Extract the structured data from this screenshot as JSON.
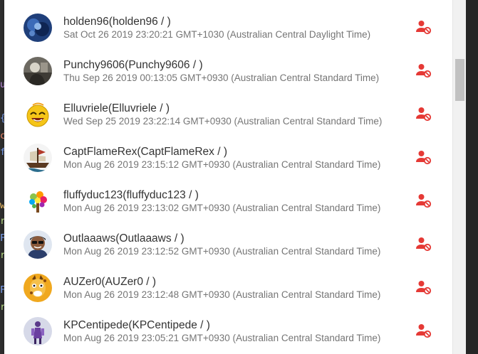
{
  "colors": {
    "accent_red": "#e53935",
    "name_text": "#333333",
    "date_text": "#757575"
  },
  "users": [
    {
      "name": "holden96(holden96 / )",
      "date": "Sat Oct 26 2019 23:20:21 GMT+1030 (Australian Central Daylight Time)",
      "avatar_icon": "avatar-photo-icon",
      "action_icon": "remove-user-icon"
    },
    {
      "name": "Punchy9606(Punchy9606 / )",
      "date": "Thu Sep 26 2019 00:13:05 GMT+0930 (Australian Central Standard Time)",
      "avatar_icon": "avatar-photo-icon",
      "action_icon": "remove-user-icon"
    },
    {
      "name": "Elluvriele(Elluvriele / )",
      "date": "Wed Sep 25 2019 23:22:14 GMT+0930 (Australian Central Standard Time)",
      "avatar_icon": "avatar-emoji-icon",
      "action_icon": "remove-user-icon"
    },
    {
      "name": "CaptFlameRex(CaptFlameRex / )",
      "date": "Mon Aug 26 2019 23:15:12 GMT+0930 (Australian Central Standard Time)",
      "avatar_icon": "avatar-ship-icon",
      "action_icon": "remove-user-icon"
    },
    {
      "name": "fluffyduc123(fluffyduc123 / )",
      "date": "Mon Aug 26 2019 23:13:02 GMT+0930 (Australian Central Standard Time)",
      "avatar_icon": "avatar-tree-icon",
      "action_icon": "remove-user-icon"
    },
    {
      "name": "Outlaaaws(Outlaaaws / )",
      "date": "Mon Aug 26 2019 23:12:52 GMT+0930 (Australian Central Standard Time)",
      "avatar_icon": "avatar-cartoon-icon",
      "action_icon": "remove-user-icon"
    },
    {
      "name": "AUZer0(AUZer0 / )",
      "date": "Mon Aug 26 2019 23:12:48 GMT+0930 (Australian Central Standard Time)",
      "avatar_icon": "avatar-giraffe-icon",
      "action_icon": "remove-user-icon"
    },
    {
      "name": "KPCentipede(KPCentipede / )",
      "date": "Mon Aug 26 2019 23:05:21 GMT+0930 (Australian Central Standard Time)",
      "avatar_icon": "avatar-figure-icon",
      "action_icon": "remove-user-icon"
    }
  ]
}
